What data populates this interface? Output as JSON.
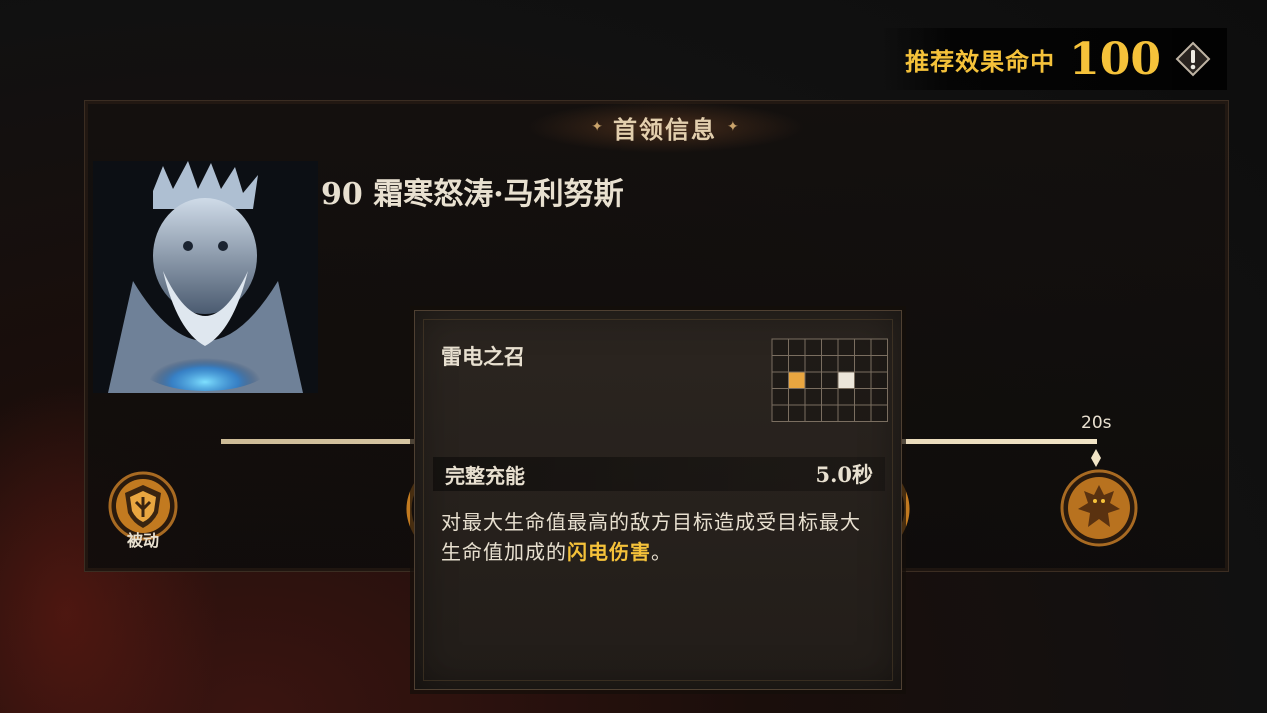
{
  "recommend": {
    "label": "推荐效果命中",
    "value": "100",
    "accent": "#f5c23a",
    "icon": "warning-icon"
  },
  "panel": {
    "title": "首领信息",
    "boss_name": "90 霜寒怒涛·马利努斯"
  },
  "timeline": {
    "time_label": "20s",
    "passive_label": "被动"
  },
  "tooltip": {
    "skill_name": "雷电之召",
    "stat_label": "完整充能",
    "stat_value": "5.0秒",
    "desc_part1": "对最大生命值最高的敌方目标造成受目标最大生命值加成的",
    "desc_highlight": "闪电伤害",
    "desc_part2": "。"
  }
}
